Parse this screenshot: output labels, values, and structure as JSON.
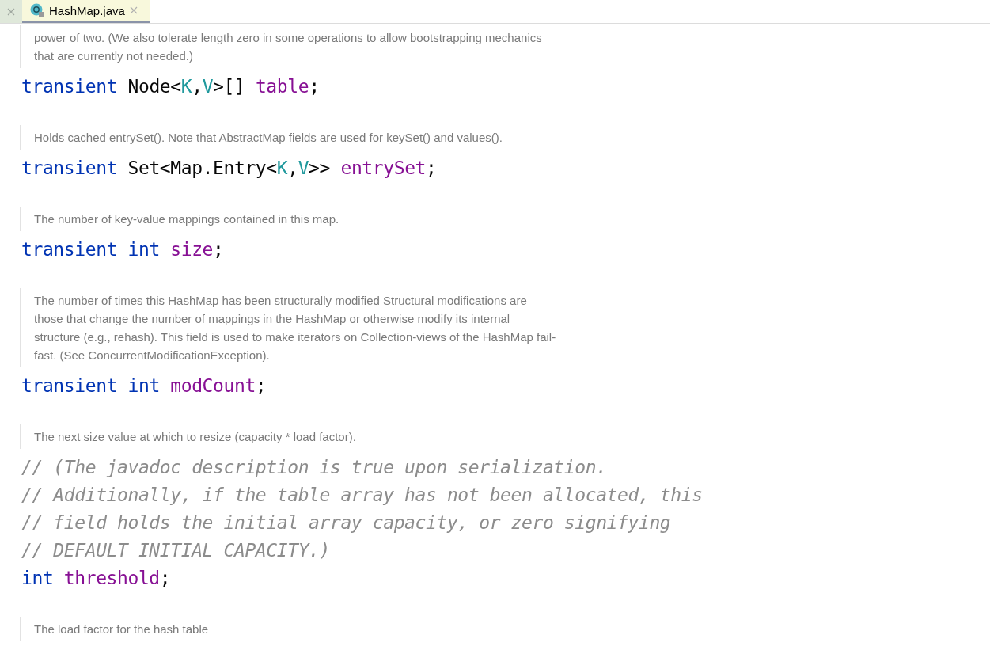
{
  "tabs": [
    {
      "label": "HashMap.java",
      "selected": true
    }
  ],
  "blocks": [
    {
      "kind": "doc",
      "lines": [
        "power of two. (We also tolerate length zero in some operations to allow bootstrapping mechanics",
        "that are currently not needed.)"
      ]
    },
    {
      "kind": "code",
      "tokens": [
        {
          "kind": "keyword",
          "text": "transient"
        },
        {
          "kind": "type",
          "text": "Node<"
        },
        {
          "kind": "param",
          "text": "K"
        },
        {
          "kind": "type",
          "text": ","
        },
        {
          "kind": "param",
          "text": "V"
        },
        {
          "kind": "type",
          "text": ">[]"
        },
        {
          "kind": "field",
          "text": "table"
        },
        {
          "kind": "punct",
          "text": ";"
        }
      ]
    },
    {
      "kind": "doc",
      "lines": [
        "Holds cached entrySet(). Note that AbstractMap fields are used for keySet() and values()."
      ]
    },
    {
      "kind": "code",
      "tokens": [
        {
          "kind": "keyword",
          "text": "transient"
        },
        {
          "kind": "type",
          "text": "Set<Map.Entry<"
        },
        {
          "kind": "param",
          "text": "K"
        },
        {
          "kind": "type",
          "text": ","
        },
        {
          "kind": "param",
          "text": "V"
        },
        {
          "kind": "type",
          "text": ">>"
        },
        {
          "kind": "field",
          "text": "entrySet"
        },
        {
          "kind": "punct",
          "text": ";"
        }
      ]
    },
    {
      "kind": "doc",
      "lines": [
        "The number of key-value mappings contained in this map."
      ]
    },
    {
      "kind": "code",
      "tokens": [
        {
          "kind": "keyword",
          "text": "transient"
        },
        {
          "kind": "keyword",
          "text": "int"
        },
        {
          "kind": "field",
          "text": "size"
        },
        {
          "kind": "punct",
          "text": ";"
        }
      ]
    },
    {
      "kind": "doc",
      "lines": [
        "The number of times this HashMap has been structurally modified Structural modifications are",
        "those that change the number of mappings in the HashMap or otherwise modify its internal",
        "structure (e.g., rehash). This field is used to make iterators on Collection-views of the HashMap fail-",
        "fast. (See ConcurrentModificationException)."
      ]
    },
    {
      "kind": "code",
      "tokens": [
        {
          "kind": "keyword",
          "text": "transient"
        },
        {
          "kind": "keyword",
          "text": "int"
        },
        {
          "kind": "field",
          "text": "modCount"
        },
        {
          "kind": "punct",
          "text": ";"
        }
      ]
    },
    {
      "kind": "doc",
      "lines": [
        "The next size value at which to resize (capacity * load factor)."
      ]
    },
    {
      "kind": "comment",
      "text": "// (The javadoc description is true upon serialization."
    },
    {
      "kind": "comment",
      "text": "// Additionally, if the table array has not been allocated, this"
    },
    {
      "kind": "comment",
      "text": "// field holds the initial array capacity, or zero signifying"
    },
    {
      "kind": "comment",
      "text": "// DEFAULT_INITIAL_CAPACITY.)"
    },
    {
      "kind": "code",
      "tokens": [
        {
          "kind": "keyword",
          "text": "int"
        },
        {
          "kind": "field",
          "text": "threshold"
        },
        {
          "kind": "punct",
          "text": ";"
        }
      ]
    },
    {
      "kind": "doc",
      "lines": [
        "The load factor for the hash table"
      ]
    }
  ]
}
